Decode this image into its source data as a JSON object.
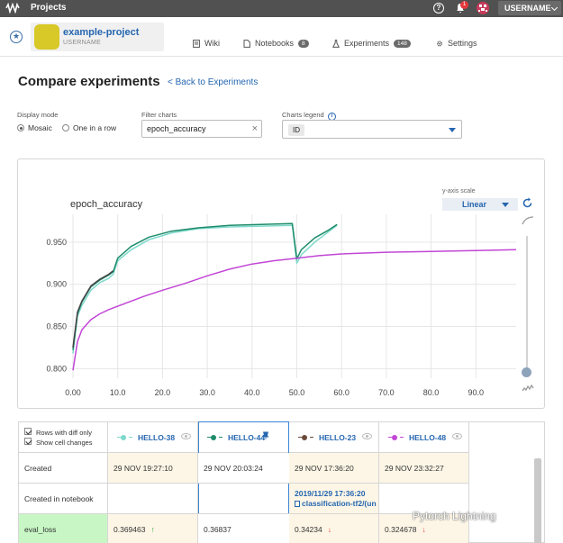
{
  "topbar": {
    "crumb": "Projects",
    "notification_count": "1",
    "username": "USERNAME"
  },
  "project": {
    "name": "example-project",
    "owner": "USERNAME"
  },
  "nav": [
    {
      "label": "Wiki",
      "count": ""
    },
    {
      "label": "Notebooks",
      "count": "8"
    },
    {
      "label": "Experiments",
      "count": "148"
    },
    {
      "label": "Settings",
      "count": ""
    }
  ],
  "page": {
    "title": "Compare experiments",
    "back_link": "< Back to Experiments"
  },
  "controls": {
    "display_mode_label": "Display mode",
    "mosaic": "Mosaic",
    "one_in_row": "One in a row",
    "filter_label": "Filter charts",
    "filter_value": "epoch_accuracy",
    "legend_label": "Charts legend",
    "legend_value": "ID"
  },
  "chart": {
    "y_scale_label": "y-axis scale",
    "y_scale_value": "Linear"
  },
  "chart_data": {
    "type": "line",
    "title": "epoch_accuracy",
    "xlabel": "",
    "ylabel": "",
    "xlim": [
      0,
      99
    ],
    "ylim": [
      0.795,
      0.983
    ],
    "x_ticks": [
      "0.00",
      "10.0",
      "20.0",
      "30.0",
      "40.0",
      "50.0",
      "60.0",
      "70.0",
      "80.0",
      "90.0"
    ],
    "y_ticks": [
      "0.800",
      "0.850",
      "0.900",
      "0.950"
    ],
    "grid": true,
    "series": [
      {
        "color": "#7ed8cc",
        "x": [
          0,
          1,
          2,
          4,
          6,
          8,
          9,
          10,
          13,
          17,
          22,
          28,
          35,
          42,
          49,
          50,
          51,
          54,
          57,
          59
        ],
        "y": [
          0.818,
          0.862,
          0.875,
          0.893,
          0.902,
          0.907,
          0.912,
          0.928,
          0.941,
          0.953,
          0.961,
          0.966,
          0.968,
          0.969,
          0.97,
          0.925,
          0.935,
          0.95,
          0.962,
          0.97
        ]
      },
      {
        "color": "#1e8c6a",
        "x": [
          0,
          1,
          2,
          4,
          6,
          8,
          9,
          10,
          13,
          17,
          22,
          28,
          35,
          42,
          49,
          50,
          51,
          54,
          57,
          59
        ],
        "y": [
          0.822,
          0.865,
          0.879,
          0.897,
          0.905,
          0.911,
          0.915,
          0.931,
          0.945,
          0.956,
          0.963,
          0.967,
          0.97,
          0.971,
          0.972,
          0.93,
          0.941,
          0.955,
          0.964,
          0.971
        ]
      },
      {
        "color": "#444444",
        "x": [
          0,
          1,
          2,
          4,
          6,
          8,
          9
        ],
        "y": [
          0.825,
          0.867,
          0.88,
          0.898,
          0.906,
          0.912,
          0.916
        ]
      },
      {
        "color": "#c246d6",
        "x": [
          0,
          1,
          2,
          4,
          6,
          8,
          12,
          16,
          20,
          25,
          30,
          35,
          40,
          45,
          50,
          55,
          60,
          70,
          80,
          90,
          99
        ],
        "y": [
          0.798,
          0.832,
          0.846,
          0.858,
          0.865,
          0.87,
          0.878,
          0.886,
          0.893,
          0.901,
          0.91,
          0.918,
          0.924,
          0.928,
          0.931,
          0.934,
          0.936,
          0.938,
          0.939,
          0.94,
          0.941
        ]
      }
    ]
  },
  "table": {
    "options": [
      "Rows with diff only",
      "Show cell changes"
    ],
    "columns": [
      {
        "name": "HELLO-38",
        "color": "#7ed8cc"
      },
      {
        "name": "HELLO-44",
        "color": "#1e8c6a"
      },
      {
        "name": "HELLO-23",
        "color": "#6b4a3a"
      },
      {
        "name": "HELLO-48",
        "color": "#c246d6"
      }
    ],
    "rows": [
      {
        "label": "Created",
        "values": [
          "29 NOV 19:27:10",
          "29 NOV 20:03:24",
          "29 NOV 17:36:20",
          "29 NOV 23:32:27"
        ]
      },
      {
        "label": "Created in notebook",
        "values": [
          "",
          "",
          "2019/11/29 17:36:20",
          ""
        ],
        "link_line2": "classification-tf2/(un"
      },
      {
        "label": "eval_loss",
        "values": [
          "0.369463",
          "0.36837",
          "0.34234",
          "0.324678"
        ]
      }
    ],
    "arrows": [
      "↑",
      "",
      "↓",
      "↓"
    ]
  },
  "watermark": "Pytorch Lightning",
  "colors": {
    "accent": "#2566b0",
    "topbar": "#515151",
    "created_highlight": "#fdf6e6",
    "loss_highlight": "#c8f7c5",
    "selected_border": "#3b86d6"
  }
}
